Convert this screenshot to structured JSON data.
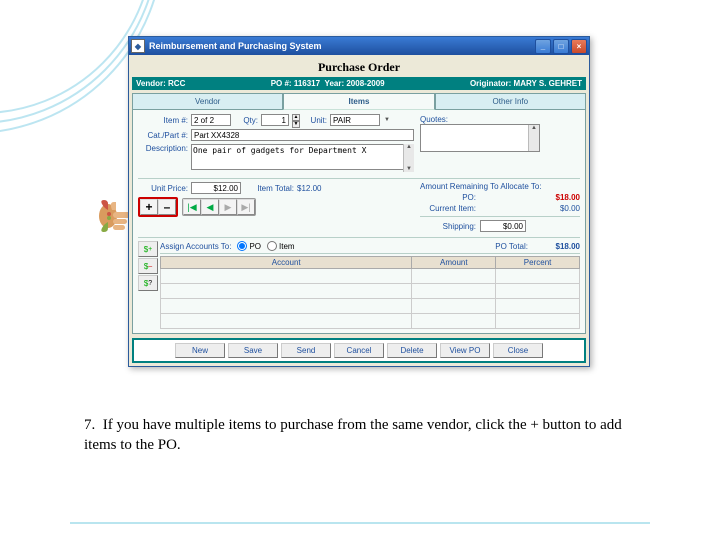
{
  "titlebar": {
    "app_name": "Reimbursement and Purchasing System"
  },
  "page_title": "Purchase Order",
  "infobar": {
    "vendor_label": "Vendor:",
    "vendor": "RCC",
    "po_label": "PO #:",
    "po": "116317",
    "year_label": "Year:",
    "year": "2008-2009",
    "orig_label": "Originator:",
    "orig": "MARY S. GEHRET"
  },
  "tabs": {
    "vendor": "Vendor",
    "items": "Items",
    "other": "Other Info"
  },
  "item": {
    "item_no_label": "Item #:",
    "item_no": "2 of 2",
    "qty_label": "Qty:",
    "qty": "1",
    "unit_label": "Unit:",
    "unit": "PAIR",
    "cat_label": "Cat./Part #:",
    "cat": "Part XX4328",
    "desc_label": "Description:",
    "desc": "One pair of gadgets for Department X",
    "unit_price_label": "Unit Price:",
    "unit_price": "$12.00",
    "item_total_label": "Item Total:",
    "item_total": "$12.00",
    "quotes_label": "Quotes:"
  },
  "amounts": {
    "remaining_label": "Amount Remaining To Allocate To:",
    "po_label": "PO:",
    "po": "$18.00",
    "curitem_label": "Current Item:",
    "curitem": "$0.00",
    "shipping_label": "Shipping:",
    "shipping": "$0.00",
    "pototal_label": "PO Total:",
    "pototal": "$18.00"
  },
  "assign": {
    "label": "Assign Accounts To:",
    "po": "PO",
    "item": "Item"
  },
  "tablehdr": {
    "account": "Account",
    "amount": "Amount",
    "percent": "Percent"
  },
  "buttons": {
    "new": "New",
    "save": "Save",
    "send": "Send",
    "cancel": "Cancel",
    "delete": "Delete",
    "view": "View PO",
    "close": "Close"
  },
  "nav": {
    "first": "|◀",
    "prev": "◀",
    "next": "▶",
    "last": "▶|",
    "add": "+",
    "remove": "–"
  },
  "instruction": {
    "num": "7.",
    "text": "If you have multiple items to purchase from the same vendor, click the + button to add items to the PO."
  }
}
